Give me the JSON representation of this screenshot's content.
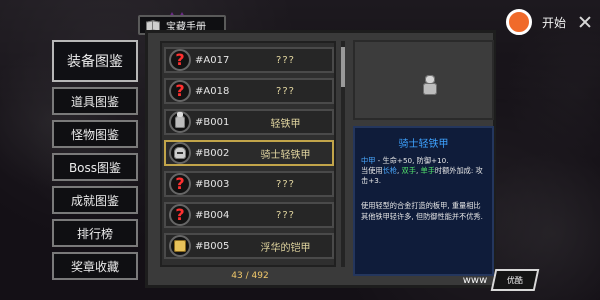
{
  "header": {
    "title": "宝藏手册"
  },
  "top_right": {
    "start_label": "开始"
  },
  "side_tabs": [
    {
      "label": "装备图鉴",
      "active": true
    },
    {
      "label": "道具图鉴"
    },
    {
      "label": "怪物图鉴"
    },
    {
      "label": "Boss图鉴"
    },
    {
      "label": "成就图鉴"
    },
    {
      "label": "排行榜"
    },
    {
      "label": "奖章收藏"
    }
  ],
  "list": {
    "items": [
      {
        "code": "#A017",
        "name": "???",
        "icon": "red-question-icon"
      },
      {
        "code": "#A018",
        "name": "???",
        "icon": "red-question-icon"
      },
      {
        "code": "#B001",
        "name": "轻铁甲",
        "icon": "light-armor-icon"
      },
      {
        "code": "#B002",
        "name": "骑士轻铁甲",
        "icon": "knight-helmet-icon",
        "selected": true
      },
      {
        "code": "#B003",
        "name": "???",
        "icon": "red-question-icon"
      },
      {
        "code": "#B004",
        "name": "???",
        "icon": "red-question-icon"
      },
      {
        "code": "#B005",
        "name": "浮华的铠甲",
        "icon": "gold-armor-icon"
      }
    ],
    "page": "43 / 492"
  },
  "details": {
    "title": "骑士轻铁甲",
    "lines": [
      {
        "prefix": "中甲",
        "rest": " - 生命+50, 防御+10."
      },
      {
        "prefix": "当使用",
        "blue": "长枪",
        "mid": ", ",
        "green": "双手",
        "mid2": ", ",
        "green2": "单手",
        "suffix": "时额外加成: 攻击+3."
      }
    ],
    "description": "使用轻型的合金打造的板甲, 重量相比其他铁甲轻许多, 但防御性能并不优秀."
  },
  "watermark": {
    "text": "www",
    "badge": "优酷"
  }
}
